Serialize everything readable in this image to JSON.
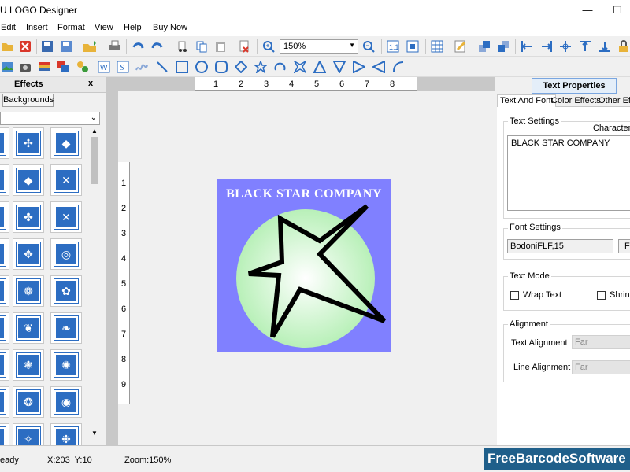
{
  "window": {
    "title": "U LOGO Designer",
    "minimize": "—",
    "maximize": "☐"
  },
  "menu": [
    "Edit",
    "Insert",
    "Format",
    "View",
    "Help",
    "Buy Now"
  ],
  "toolbar": {
    "zoom_value": "150%"
  },
  "effects_panel": {
    "title": "Effects",
    "close": "x",
    "backgrounds_button": "Backgrounds"
  },
  "ruler": {
    "h_ticks": [
      "1",
      "2",
      "3",
      "4",
      "5",
      "6",
      "7",
      "8"
    ],
    "v_ticks": [
      "1",
      "2",
      "3",
      "4",
      "5",
      "6",
      "7",
      "8",
      "9"
    ]
  },
  "logo": {
    "text": "BLACK STAR COMPANY",
    "bg_color": "#8080ff",
    "circle_color": "#b8f0b8"
  },
  "text_properties": {
    "title": "Text Properties",
    "tabs": [
      "Text And Font",
      "Color Effects",
      "Other Effe"
    ],
    "text_settings_label": "Text Settings",
    "characters_label": "Characters",
    "text_value": "BLACK STAR COMPANY",
    "font_settings_label": "Font Settings",
    "font_value": "BodoniFLF,15",
    "font_button": "F",
    "text_mode_label": "Text Mode",
    "wrap_text": "Wrap Text",
    "shrink": "Shrink",
    "alignment_label": "Alignment",
    "text_alignment_label": "Text Alignment",
    "text_alignment_value": "Far",
    "line_alignment_label": "Line Alignment",
    "line_alignment_value": "Far"
  },
  "status": {
    "ready": "eady",
    "coords": "X:203  Y:10",
    "zoom": "Zoom:150%",
    "brand": "FreeBarcodeSoftware"
  }
}
